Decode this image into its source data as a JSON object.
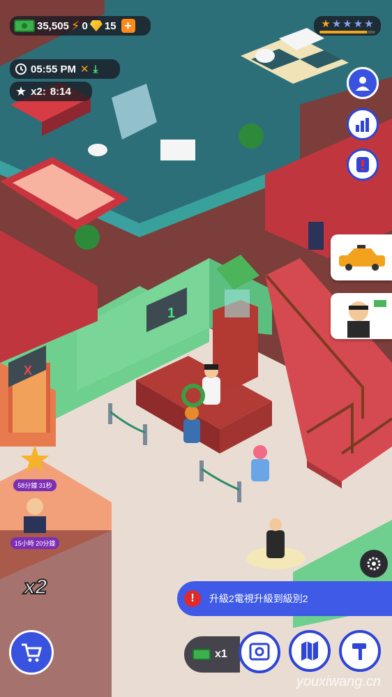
{
  "hud": {
    "cash": "35,505",
    "energy": "0",
    "gems": "15",
    "time": "05:55 PM",
    "boost_label": "x2:",
    "boost_timer": "8:14",
    "rating_stars_filled": 1,
    "rating_stars_total": 5,
    "rating_progress": 0.85
  },
  "scene": {
    "counter_sign": "1",
    "room_sign": "X"
  },
  "rewards": [
    {
      "timer": "58分鐘 31秒"
    },
    {
      "timer": "15小時 20分鐘"
    }
  ],
  "multiplier": "x2",
  "quest": {
    "alert": "!",
    "text": "升級2電視升級到級別2"
  },
  "bottom": {
    "cash_multiplier": "x1"
  },
  "watermark": "youxiwang.cn",
  "colors": {
    "accent": "#3a52e0",
    "cash_green": "#3db04d",
    "wall_green": "#6fcf8e",
    "floor_beige": "#e9ddd3",
    "wall_red": "#c0363f",
    "road": "#7b3e3a",
    "pool_teal": "#2c7a85"
  },
  "icons": [
    "cash-icon",
    "bolt-icon",
    "gem-icon",
    "plus-icon",
    "clock-icon",
    "utensils-icon",
    "download-icon",
    "star-icon",
    "manager-icon",
    "stats-icon",
    "alert-icon",
    "taxi-icon",
    "boss-icon",
    "settings-icon",
    "cart-icon",
    "safe-icon",
    "map-icon",
    "hammer-icon"
  ]
}
